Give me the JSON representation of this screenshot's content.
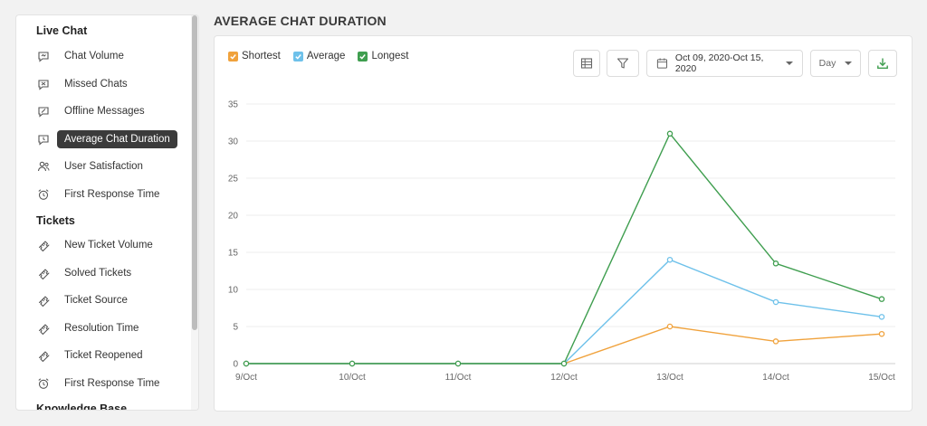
{
  "sidebar": {
    "sections": [
      {
        "title": "Live Chat",
        "items": [
          {
            "label": "Chat Volume",
            "icon": "chat-volume-icon"
          },
          {
            "label": "Missed Chats",
            "icon": "missed-chats-icon"
          },
          {
            "label": "Offline Messages",
            "icon": "offline-messages-icon"
          },
          {
            "label": "Average Chat Duration",
            "icon": "chat-duration-icon",
            "active": true
          },
          {
            "label": "User Satisfaction",
            "icon": "user-satisfaction-icon"
          },
          {
            "label": "First Response Time",
            "icon": "alarm-clock-icon"
          }
        ]
      },
      {
        "title": "Tickets",
        "items": [
          {
            "label": "New Ticket Volume",
            "icon": "ticket-icon"
          },
          {
            "label": "Solved Tickets",
            "icon": "ticket-icon"
          },
          {
            "label": "Ticket Source",
            "icon": "ticket-icon"
          },
          {
            "label": "Resolution Time",
            "icon": "ticket-icon"
          },
          {
            "label": "Ticket Reopened",
            "icon": "ticket-icon"
          },
          {
            "label": "First Response Time",
            "icon": "alarm-clock-icon"
          }
        ]
      },
      {
        "title": "Knowledge Base",
        "items": []
      }
    ]
  },
  "main": {
    "title": "AVERAGE CHAT DURATION",
    "legend": [
      {
        "label": "Shortest",
        "color": "#f0a23c"
      },
      {
        "label": "Average",
        "color": "#6ec1ea"
      },
      {
        "label": "Longest",
        "color": "#3f9e4f"
      }
    ],
    "toolbar": {
      "date_range": "Oct 09, 2020-Oct 15, 2020",
      "granularity": "Day"
    }
  },
  "chart_data": {
    "type": "line",
    "categories": [
      "9/Oct",
      "10/Oct",
      "11/Oct",
      "12/Oct",
      "13/Oct",
      "14/Oct",
      "15/Oct"
    ],
    "series": [
      {
        "name": "Shortest",
        "color": "#f0a23c",
        "values": [
          0,
          0,
          0,
          0,
          5,
          3,
          4
        ]
      },
      {
        "name": "Average",
        "color": "#6ec1ea",
        "values": [
          0,
          0,
          0,
          0,
          14,
          8.3,
          6.3
        ]
      },
      {
        "name": "Longest",
        "color": "#3f9e4f",
        "values": [
          0,
          0,
          0,
          0,
          31,
          13.5,
          8.7
        ]
      }
    ],
    "ylim": [
      0,
      35
    ],
    "yticks": [
      0,
      5,
      10,
      15,
      20,
      25,
      30,
      35
    ],
    "grid": true
  }
}
